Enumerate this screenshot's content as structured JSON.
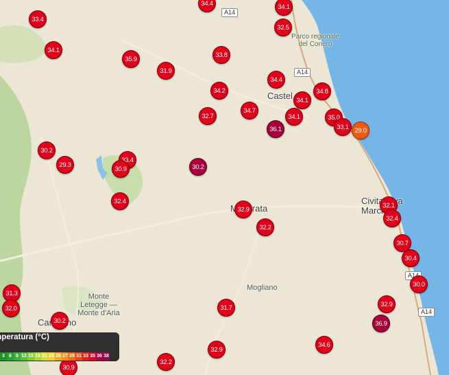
{
  "legend": {
    "title": "mperatura (°C)",
    "stops": [
      {
        "label": "3",
        "color": "#1f8f2a"
      },
      {
        "label": "6",
        "color": "#2c9e35"
      },
      {
        "label": "9",
        "color": "#3aae40"
      },
      {
        "label": "12",
        "color": "#5bbd3a"
      },
      {
        "label": "15",
        "color": "#7fcb34"
      },
      {
        "label": "18",
        "color": "#a8d632"
      },
      {
        "label": "21",
        "color": "#d4dd2f"
      },
      {
        "label": "23",
        "color": "#f0d12b"
      },
      {
        "label": "26",
        "color": "#f6a81f"
      },
      {
        "label": "27",
        "color": "#f48a1a"
      },
      {
        "label": "29",
        "color": "#f06a18"
      },
      {
        "label": "31",
        "color": "#e84418"
      },
      {
        "label": "33",
        "color": "#e2201c"
      },
      {
        "label": "35",
        "color": "#d0082e"
      },
      {
        "label": "36",
        "color": "#b0003f"
      },
      {
        "label": "38",
        "color": "#8a0a4a"
      }
    ]
  },
  "places": {
    "castel": "Castel",
    "parco": "Parco regionale\ndel Conero",
    "macerata": "Macerata",
    "civitanova": "Civitanova\nMarche",
    "mogliano": "Mogliano",
    "monte": "Monte\nLetegge —\nMonte d'Aria",
    "camerino": "Camerino"
  },
  "roads": [
    "A14",
    "A14",
    "A14",
    "A14"
  ],
  "stations": [
    {
      "value": "33.4",
      "tone": "normal"
    },
    {
      "value": "34.4",
      "tone": "normal"
    },
    {
      "value": "34.1",
      "tone": "normal"
    },
    {
      "value": "32.5",
      "tone": "normal"
    },
    {
      "value": "34.1",
      "tone": "normal"
    },
    {
      "value": "35.9",
      "tone": "normal"
    },
    {
      "value": "33.8",
      "tone": "normal"
    },
    {
      "value": "31.9",
      "tone": "normal"
    },
    {
      "value": "34.4",
      "tone": "normal"
    },
    {
      "value": "34.2",
      "tone": "normal"
    },
    {
      "value": "34.8",
      "tone": "normal"
    },
    {
      "value": "34.1",
      "tone": "normal"
    },
    {
      "value": "32.7",
      "tone": "normal"
    },
    {
      "value": "34.7",
      "tone": "normal"
    },
    {
      "value": "34.1",
      "tone": "normal"
    },
    {
      "value": "36.1",
      "tone": "hot"
    },
    {
      "value": "35.0",
      "tone": "normal"
    },
    {
      "value": "33.1",
      "tone": "normal"
    },
    {
      "value": "29.0",
      "tone": "warm"
    },
    {
      "value": "30.2",
      "tone": "normal"
    },
    {
      "value": "33.4",
      "tone": "normal"
    },
    {
      "value": "29.3",
      "tone": "normal"
    },
    {
      "value": "30.9",
      "tone": "normal"
    },
    {
      "value": "30.2",
      "tone": "hot"
    },
    {
      "value": "32.4",
      "tone": "normal"
    },
    {
      "value": "32.9",
      "tone": "normal"
    },
    {
      "value": "32.1",
      "tone": "normal"
    },
    {
      "value": "32.2",
      "tone": "normal"
    },
    {
      "value": "32.4",
      "tone": "normal"
    },
    {
      "value": "30.7",
      "tone": "normal"
    },
    {
      "value": "30.4",
      "tone": "normal"
    },
    {
      "value": "30.0",
      "tone": "normal"
    },
    {
      "value": "31.3",
      "tone": "normal"
    },
    {
      "value": "32.0",
      "tone": "normal"
    },
    {
      "value": "31.7",
      "tone": "normal"
    },
    {
      "value": "32.9",
      "tone": "normal"
    },
    {
      "value": "36.9",
      "tone": "hot"
    },
    {
      "value": "30.2",
      "tone": "normal"
    },
    {
      "value": "34.6",
      "tone": "normal"
    },
    {
      "value": "32.9",
      "tone": "normal"
    },
    {
      "value": "32.2",
      "tone": "normal"
    },
    {
      "value": "30.9",
      "tone": "normal"
    }
  ]
}
